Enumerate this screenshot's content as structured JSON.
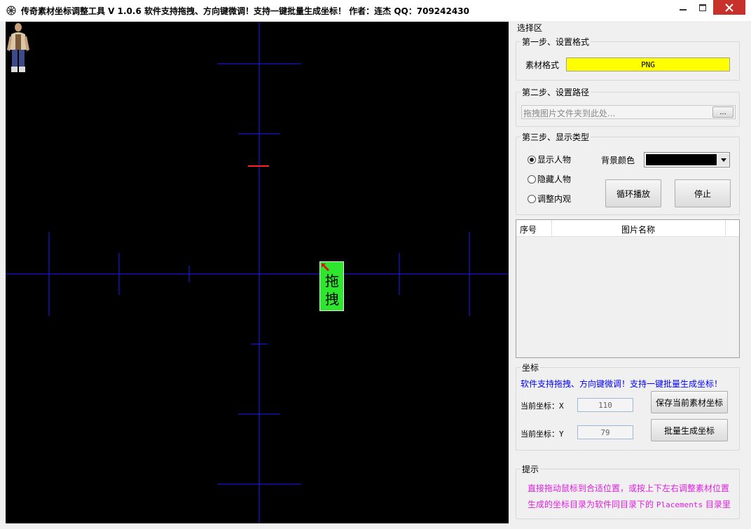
{
  "window": {
    "title": "传奇素材坐标调整工具 V 1.0.6  软件支持拖拽、方向键微调！支持一键批量生成坐标！ 作者：连杰 QQ：709242430",
    "buttons": {
      "minimize": "minimize-icon",
      "maximize": "maximize-icon",
      "close": "close-icon"
    }
  },
  "canvas": {
    "drag_label": "拖拽",
    "background": "#000000",
    "crosshair_color": "#0000ff",
    "marker_color": "#ff0000"
  },
  "panel": {
    "title": "选择区",
    "step1": {
      "label": "第一步、设置格式",
      "format_label": "素材格式",
      "format_value": "PNG",
      "format_color": "#ffff00"
    },
    "step2": {
      "label": "第二步、设置路径",
      "path_placeholder": "拖拽图片文件夹到此处...",
      "browse_label": "..."
    },
    "step3": {
      "label": "第三步、显示类型",
      "radios": [
        {
          "label": "显示人物",
          "checked": true
        },
        {
          "label": "隐藏人物",
          "checked": false
        },
        {
          "label": "调整内观",
          "checked": false
        }
      ],
      "bg_color_label": "背景颜色",
      "bg_color_value": "#000000",
      "loop_play_label": "循环播放",
      "stop_label": "停止"
    },
    "list": {
      "columns": [
        "序号",
        "图片名称"
      ],
      "rows": []
    },
    "coords": {
      "label": "坐标",
      "info": "软件支持拖拽、方向键微调！支持一键批量生成坐标！",
      "info_color": "#0000ff",
      "x_label": "当前坐标：X",
      "x_value": "110",
      "y_label": "当前坐标：Y",
      "y_value": "79",
      "save_label": "保存当前素材坐标",
      "batch_label": "批量生成坐标"
    },
    "tips": {
      "label": "提示",
      "line1": "直接拖动鼠标到合适位置，或按上下左右调整素材位置",
      "line2_pre": "生成的坐标目录为软件同目录下的",
      "line2_code": "Placements",
      "line2_post": "目录里",
      "color": "#e020e0"
    }
  }
}
